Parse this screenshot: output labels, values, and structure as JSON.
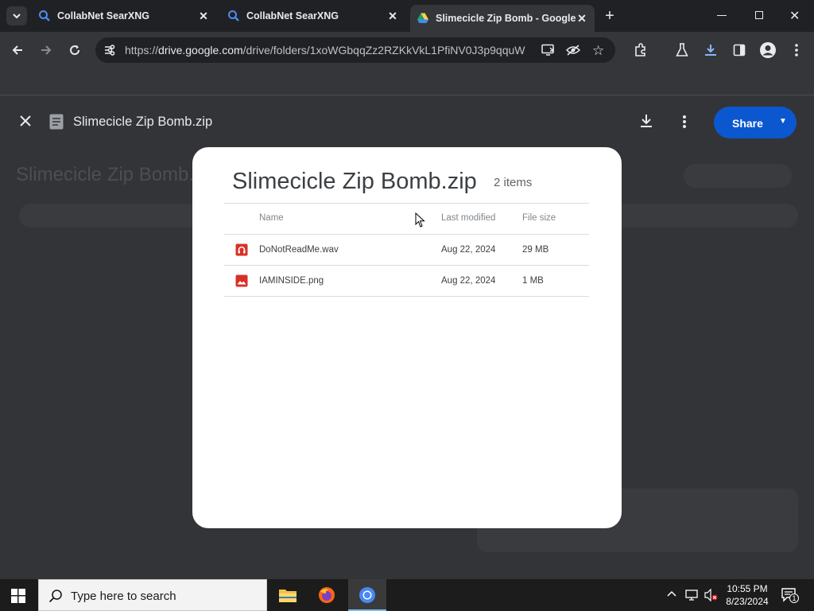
{
  "browser": {
    "tabs": [
      {
        "title": "CollabNet SearXNG",
        "active": false
      },
      {
        "title": "CollabNet SearXNG",
        "active": false
      },
      {
        "title": "Slimecicle Zip Bomb - Google Drive",
        "active": true
      }
    ],
    "url_scheme": "https://",
    "url_domain": "drive.google.com",
    "url_path": "/drive/folders/1xoWGbqqZz2RZKkVkL1PfiNV0J3p9qquW"
  },
  "viewer": {
    "file_title": "Slimecicle Zip Bomb.zip",
    "share_label": "Share"
  },
  "dialog": {
    "title": "Slimecicle Zip Bomb.zip",
    "count": "2 items",
    "columns": {
      "name": "Name",
      "modified": "Last modified",
      "size": "File size"
    },
    "rows": [
      {
        "name": "DoNotReadMe.wav",
        "modified": "Aug 22, 2024",
        "size": "29 MB",
        "icon": "audio-file-icon"
      },
      {
        "name": "IAMINSIDE.png",
        "modified": "Aug 22, 2024",
        "size": "1 MB",
        "icon": "image-file-icon"
      }
    ]
  },
  "taskbar": {
    "search_placeholder": "Type here to search",
    "time": "10:55 PM",
    "date": "8/23/2024",
    "notification_count": "1"
  },
  "colors": {
    "share_button": "#0b57d0",
    "file_icon_red": "#d93025",
    "chrome_dark": "#202124"
  }
}
